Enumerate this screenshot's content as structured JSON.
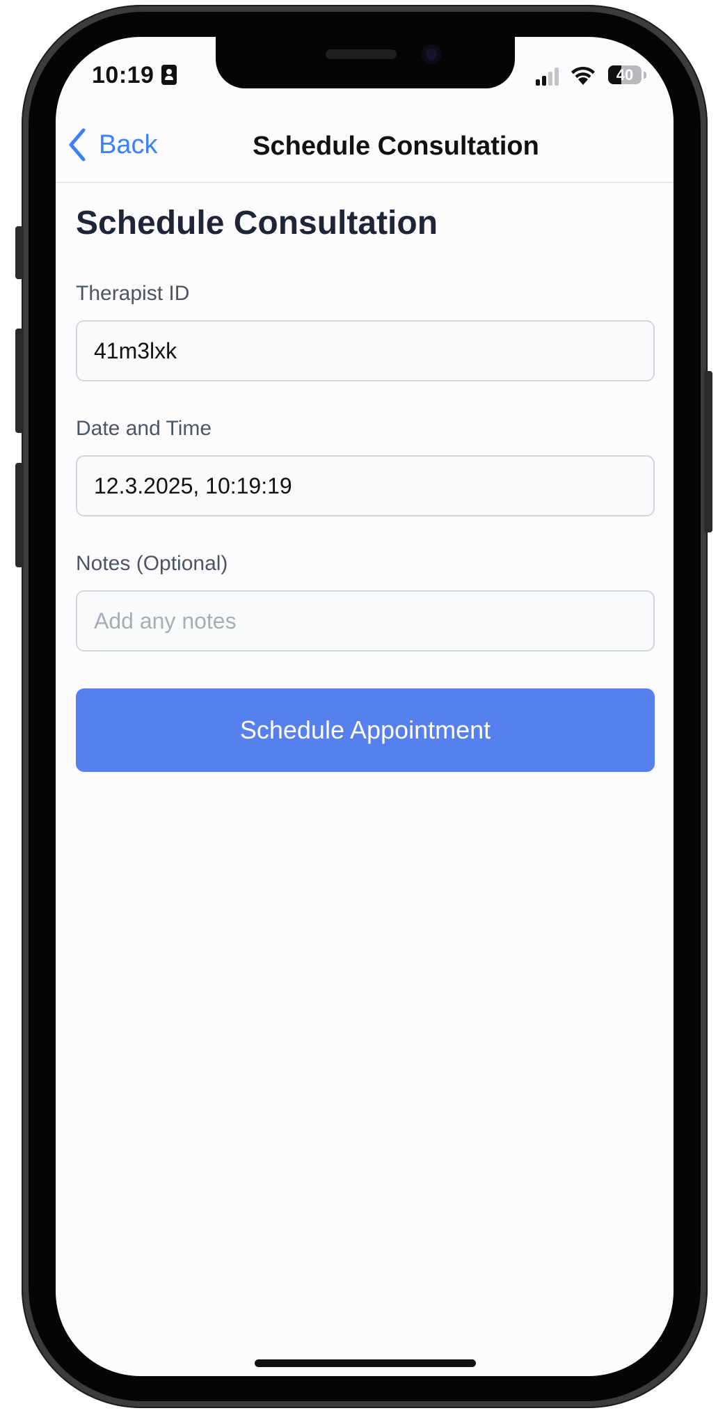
{
  "status_bar": {
    "time": "10:19",
    "battery_level": "40",
    "battery_fraction": 0.4,
    "signal_bars_active": 2,
    "signal_bars_total": 4
  },
  "nav": {
    "back_label": "Back",
    "title": "Schedule Consultation"
  },
  "page": {
    "title": "Schedule Consultation"
  },
  "form": {
    "therapist_id": {
      "label": "Therapist ID",
      "value": "41m3lxk"
    },
    "date_time": {
      "label": "Date and Time",
      "value": "12.3.2025, 10:19:19"
    },
    "notes": {
      "label": "Notes (Optional)",
      "value": "",
      "placeholder": "Add any notes"
    },
    "submit_label": "Schedule Appointment"
  },
  "colors": {
    "accent": "#3b82f6",
    "primary_button": "#5580ee",
    "background": "#fdfbfe",
    "title_text": "#1f2537"
  },
  "icons": {
    "back": "chevron-left-icon",
    "status_badge": "id-badge-icon",
    "signal": "cellular-signal-icon",
    "wifi": "wifi-icon",
    "battery": "battery-icon"
  }
}
